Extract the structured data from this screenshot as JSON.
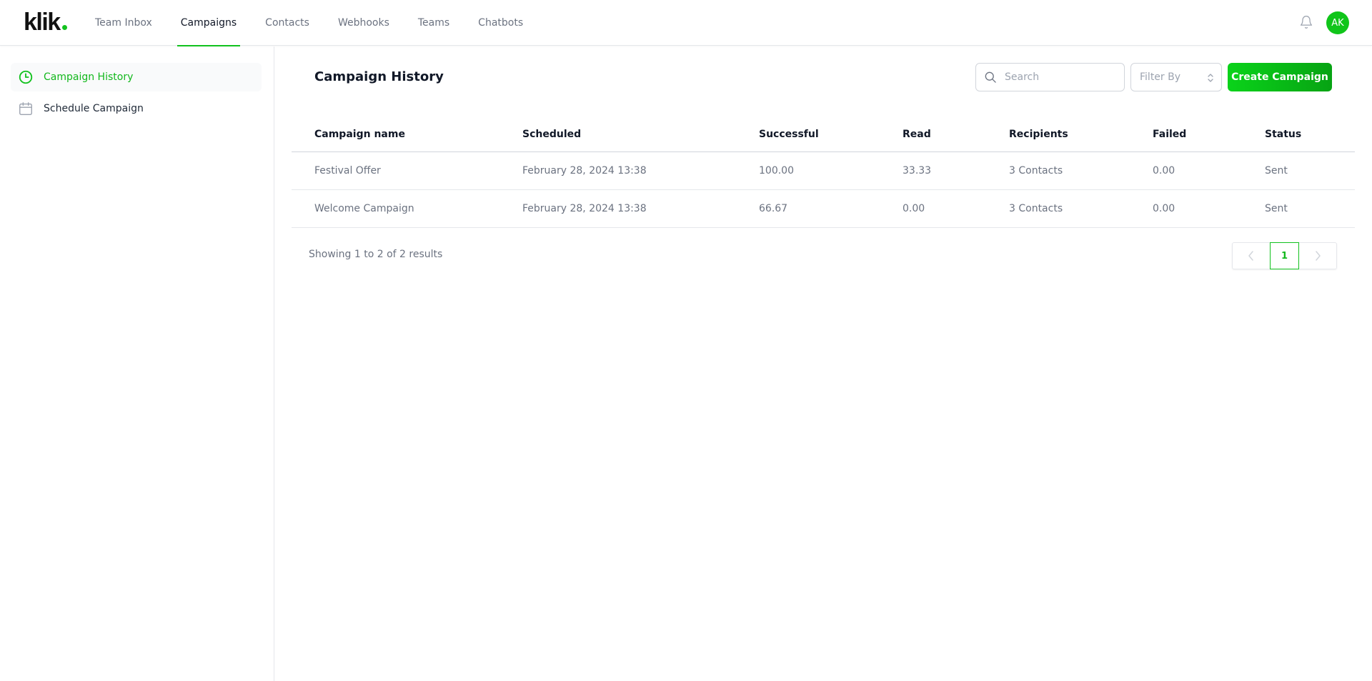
{
  "app": {
    "logo_text": "klik",
    "accent_color": "#12c21e"
  },
  "nav": {
    "items": [
      {
        "label": "Team Inbox",
        "active": false
      },
      {
        "label": "Campaigns",
        "active": true
      },
      {
        "label": "Contacts",
        "active": false
      },
      {
        "label": "Webhooks",
        "active": false
      },
      {
        "label": "Teams",
        "active": false
      },
      {
        "label": "Chatbots",
        "active": false
      }
    ],
    "notification_icon": "bell-icon",
    "avatar_initials": "AK"
  },
  "sidebar": {
    "items": [
      {
        "label": "Campaign History",
        "icon": "clock-icon",
        "active": true
      },
      {
        "label": "Schedule Campaign",
        "icon": "calendar-icon",
        "active": false
      }
    ]
  },
  "main": {
    "title": "Campaign History",
    "search": {
      "placeholder": "Search",
      "value": ""
    },
    "filter": {
      "label": "Filter By"
    },
    "create_button": "Create Campaign",
    "table": {
      "columns": [
        "Campaign name",
        "Scheduled",
        "Successful",
        "Read",
        "Recipients",
        "Failed",
        "Status"
      ],
      "rows": [
        [
          "Festival Offer",
          "February 28, 2024 13:38",
          "100.00",
          "33.33",
          "3 Contacts",
          "0.00",
          "Sent"
        ],
        [
          "Welcome Campaign",
          "February 28, 2024 13:38",
          "66.67",
          "0.00",
          "3 Contacts",
          "0.00",
          "Sent"
        ]
      ]
    },
    "footer": {
      "summary": "Showing 1 to 2 of 2 results"
    },
    "pagination": {
      "current_page": "1"
    }
  }
}
